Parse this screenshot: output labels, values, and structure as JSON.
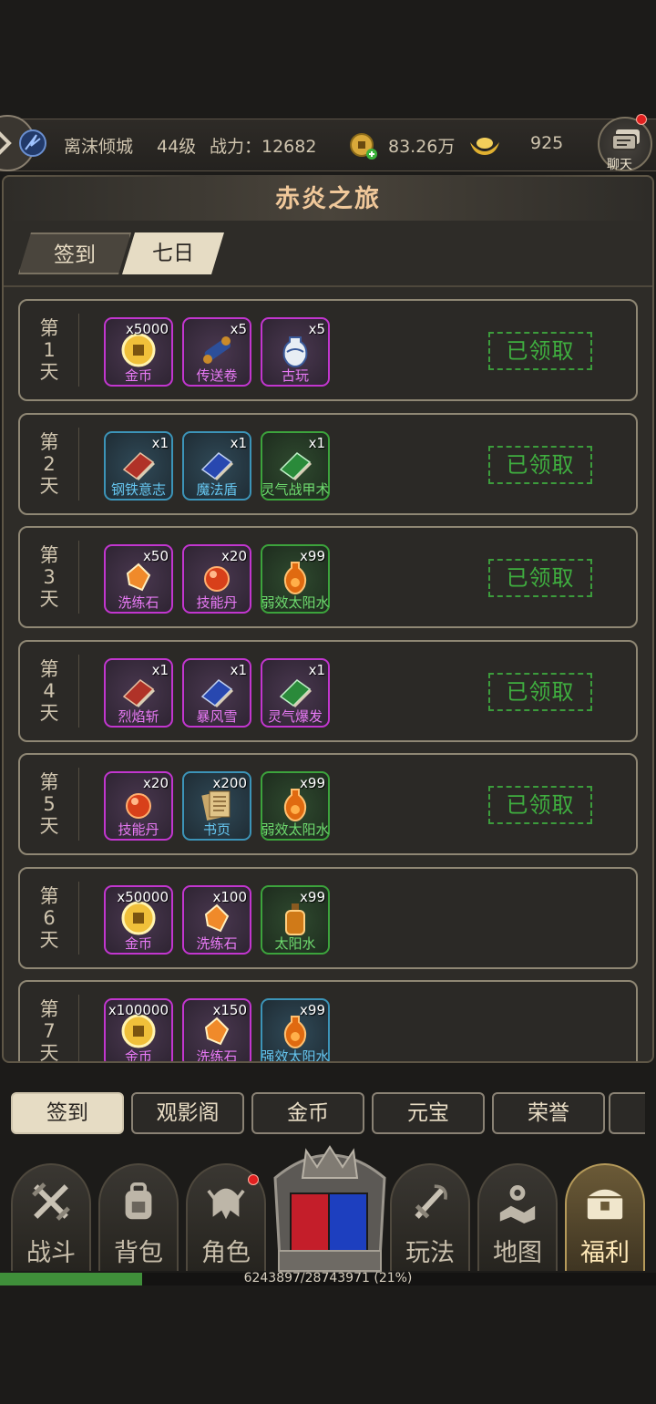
{
  "top_bar": {
    "player_name": "离沫倾城",
    "level": "44级",
    "power": "战力：12682",
    "gold": "83.26万",
    "ingots": "925",
    "chat_label": "聊天"
  },
  "panel": {
    "title": "赤炎之旅",
    "tabs": [
      {
        "label": "签到"
      },
      {
        "label": "七日"
      }
    ]
  },
  "days": [
    {
      "label": [
        "第",
        "1",
        "天"
      ],
      "status": "已领取",
      "items": [
        {
          "qty": "x5000",
          "name": "金币",
          "rarity": "purple",
          "icon": "coin-icon"
        },
        {
          "qty": "x5",
          "name": "传送卷",
          "rarity": "purple",
          "icon": "scroll-icon"
        },
        {
          "qty": "x5",
          "name": "古玩",
          "rarity": "purple",
          "icon": "vase-icon"
        }
      ]
    },
    {
      "label": [
        "第",
        "2",
        "天"
      ],
      "status": "已领取",
      "items": [
        {
          "qty": "x1",
          "name": "钢铁意志",
          "rarity": "blue",
          "icon": "red-book-icon"
        },
        {
          "qty": "x1",
          "name": "魔法盾",
          "rarity": "blue",
          "icon": "blue-book-icon"
        },
        {
          "qty": "x1",
          "name": "灵气战甲术",
          "rarity": "green",
          "icon": "green-book-icon"
        }
      ]
    },
    {
      "label": [
        "第",
        "3",
        "天"
      ],
      "status": "已领取",
      "items": [
        {
          "qty": "x50",
          "name": "洗练石",
          "rarity": "purple",
          "icon": "gem-icon"
        },
        {
          "qty": "x20",
          "name": "技能丹",
          "rarity": "purple",
          "icon": "pill-icon"
        },
        {
          "qty": "x99",
          "name": "弱效太阳水",
          "rarity": "green",
          "icon": "potion-icon"
        }
      ]
    },
    {
      "label": [
        "第",
        "4",
        "天"
      ],
      "status": "已领取",
      "items": [
        {
          "qty": "x1",
          "name": "烈焰斩",
          "rarity": "purple",
          "icon": "red-book-icon"
        },
        {
          "qty": "x1",
          "name": "暴风雪",
          "rarity": "purple",
          "icon": "blue-book-icon"
        },
        {
          "qty": "x1",
          "name": "灵气爆发",
          "rarity": "purple",
          "icon": "green-book-icon"
        }
      ]
    },
    {
      "label": [
        "第",
        "5",
        "天"
      ],
      "status": "已领取",
      "items": [
        {
          "qty": "x20",
          "name": "技能丹",
          "rarity": "purple",
          "icon": "pill-icon"
        },
        {
          "qty": "x200",
          "name": "书页",
          "rarity": "blue",
          "icon": "pages-icon"
        },
        {
          "qty": "x99",
          "name": "弱效太阳水",
          "rarity": "green",
          "icon": "potion-icon"
        }
      ]
    },
    {
      "label": [
        "第",
        "6",
        "天"
      ],
      "status": "",
      "items": [
        {
          "qty": "x50000",
          "name": "金币",
          "rarity": "purple",
          "icon": "coin-icon"
        },
        {
          "qty": "x100",
          "name": "洗练石",
          "rarity": "purple",
          "icon": "gem-icon"
        },
        {
          "qty": "x99",
          "name": "太阳水",
          "rarity": "green",
          "icon": "bottle-icon"
        }
      ]
    },
    {
      "label": [
        "第",
        "7",
        "天"
      ],
      "status": "",
      "items": [
        {
          "qty": "x100000",
          "name": "金币",
          "rarity": "purple",
          "icon": "coin-icon"
        },
        {
          "qty": "x150",
          "name": "洗练石",
          "rarity": "purple",
          "icon": "gem-icon"
        },
        {
          "qty": "x99",
          "name": "强效太阳水",
          "rarity": "blue",
          "icon": "potion-icon"
        }
      ]
    }
  ],
  "lower_tabs": [
    {
      "label": "签到",
      "active": true
    },
    {
      "label": "观影阁"
    },
    {
      "label": "金币"
    },
    {
      "label": "元宝"
    },
    {
      "label": "荣誉"
    }
  ],
  "nav": [
    {
      "label": "战斗",
      "icon": "crossed-swords-icon"
    },
    {
      "label": "背包",
      "icon": "backpack-icon"
    },
    {
      "label": "角色",
      "icon": "helmet-icon"
    },
    {
      "label": "玩法",
      "icon": "sword-icon"
    },
    {
      "label": "地图",
      "icon": "map-icon"
    },
    {
      "label": "福利",
      "icon": "treasure-chest-icon",
      "active": true
    }
  ],
  "progress": {
    "text": "6243897/28743971 (21%)",
    "fraction": 0.217
  }
}
